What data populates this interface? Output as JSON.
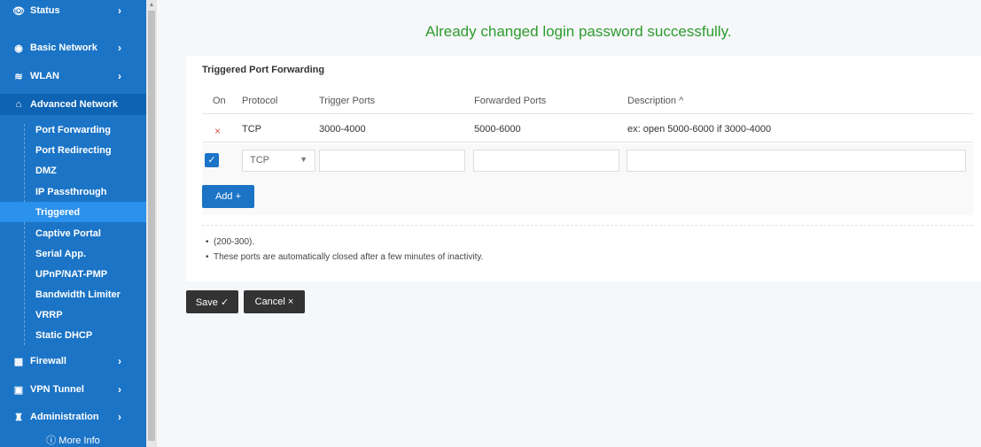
{
  "sidebar": {
    "items": [
      {
        "label": "Status",
        "icon": "eye-icon",
        "chevron": "›"
      },
      {
        "label": "Basic Network",
        "icon": "globe-icon",
        "chevron": "›"
      },
      {
        "label": "WLAN",
        "icon": "wifi-icon",
        "chevron": "›"
      },
      {
        "label": "Advanced Network",
        "icon": "network-icon"
      },
      {
        "label": "Firewall",
        "icon": "firewall-icon",
        "chevron": "›"
      },
      {
        "label": "VPN Tunnel",
        "icon": "vpn-icon",
        "chevron": "›"
      },
      {
        "label": "Administration",
        "icon": "admin-icon",
        "chevron": "›"
      }
    ],
    "subitems": [
      "Port Forwarding",
      "Port Redirecting",
      "DMZ",
      "IP Passthrough",
      "Triggered",
      "Captive Portal",
      "Serial App.",
      "UPnP/NAT-PMP",
      "Bandwidth Limiter",
      "VRRP",
      "Static DHCP"
    ],
    "selected": "Triggered",
    "more_info": "ⓘ More Info"
  },
  "main": {
    "success_message": "Already changed login password successfully.",
    "panel_title": "Triggered Port Forwarding",
    "columns": [
      "On",
      "Protocol",
      "Trigger Ports",
      "Forwarded Ports",
      "Description ^"
    ],
    "row": {
      "protocol": "TCP",
      "trigger": "3000-4000",
      "forwarded": "5000-6000",
      "description": "ex: open 5000-6000 if 3000-4000"
    },
    "new_row": {
      "protocol": "TCP",
      "checkbox_checked": true
    },
    "add_label": "Add +",
    "notes": [
      "(200-300).",
      "These ports are automatically closed after a few minutes of inactivity."
    ],
    "save_label": "Save ✓",
    "cancel_label": "Cancel ×"
  },
  "colors": {
    "sidebar": "#1b74c6",
    "selected": "#2a91ec",
    "success": "#2d9c2d",
    "button": "#1b74c6",
    "dark_button": "#333333"
  }
}
